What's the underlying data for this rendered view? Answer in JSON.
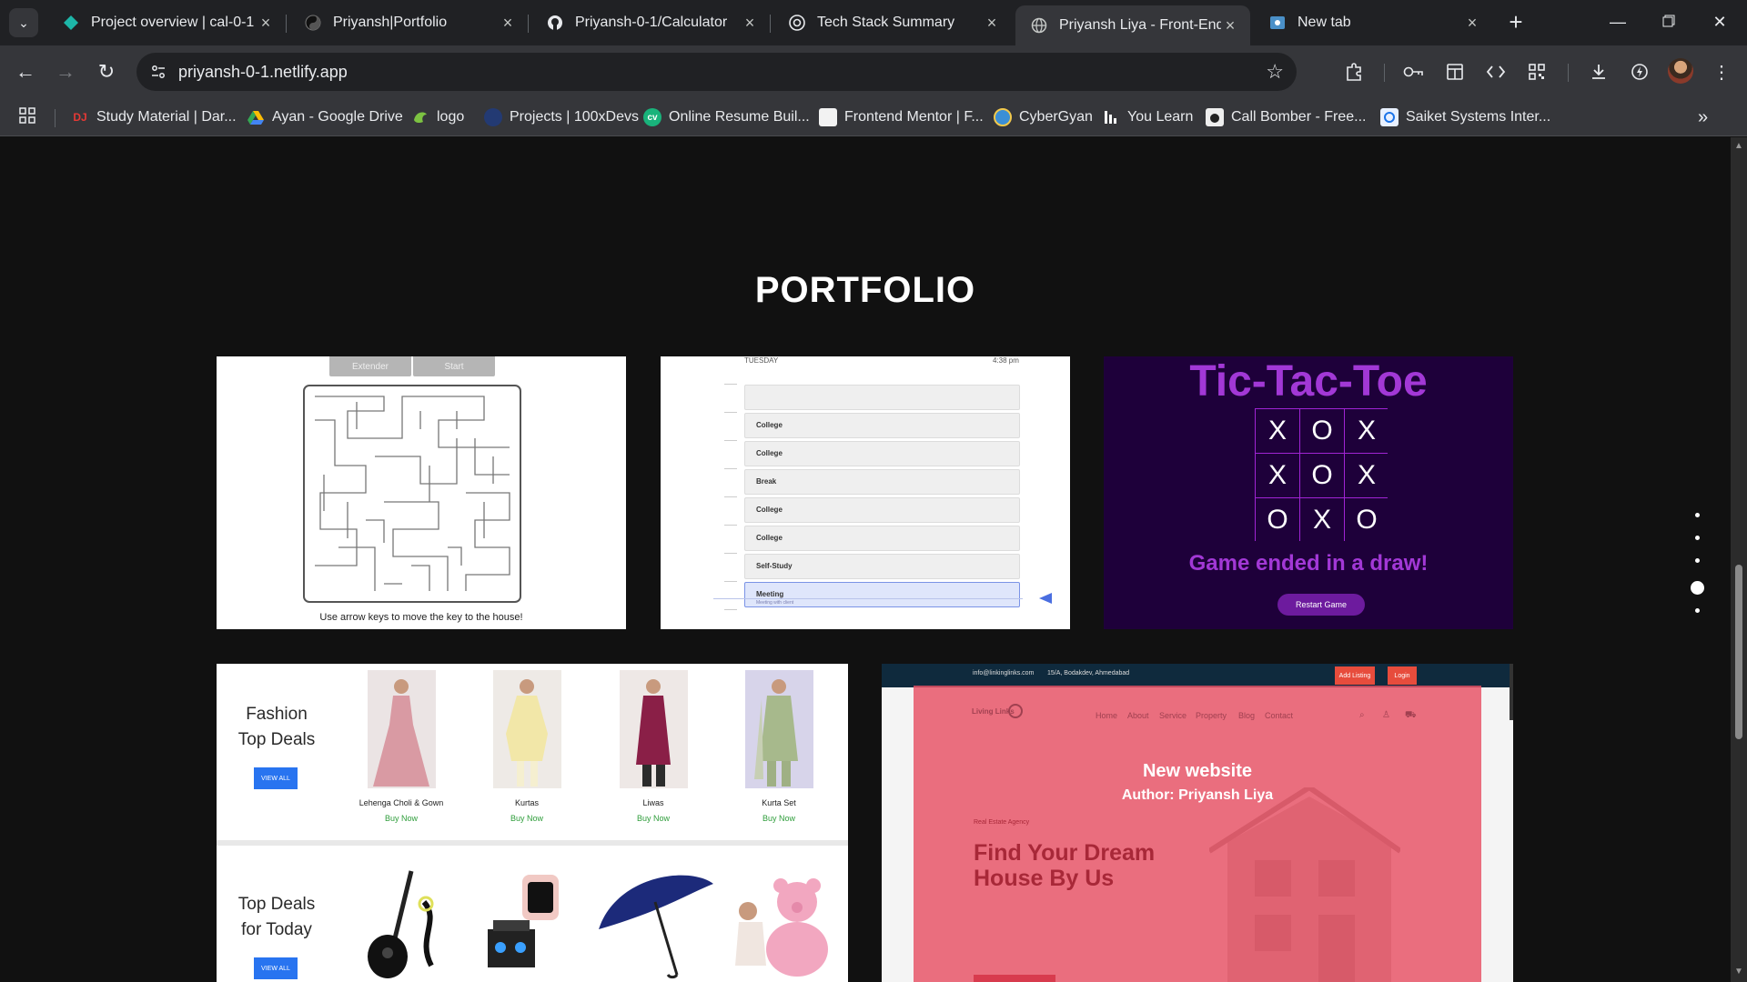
{
  "browser": {
    "tabs": [
      {
        "title": "Project overview | cal-0-1 |",
        "icon": "netlify-diamond-icon",
        "color": "#1db6a8"
      },
      {
        "title": "Priyansh|Portfolio",
        "icon": "yin-yang-icon"
      },
      {
        "title": "Priyansh-0-1/Calculator",
        "icon": "github-icon"
      },
      {
        "title": "Tech Stack Summary",
        "icon": "chatgpt-icon"
      },
      {
        "title": "Priyansh Liya - Front-End &",
        "icon": "globe-icon",
        "active": true
      },
      {
        "title": "New tab",
        "icon": "new-tab-icon"
      }
    ],
    "url": "priyansh-0-1.netlify.app",
    "bookmarks": [
      {
        "label": "Study Material | Dar...",
        "icon": "dj-icon"
      },
      {
        "label": "Ayan - Google Drive",
        "icon": "google-drive-icon"
      },
      {
        "label": "logo",
        "icon": "logo-icon"
      },
      {
        "label": "Projects | 100xDevs",
        "icon": "100xdevs-icon"
      },
      {
        "label": "Online Resume Buil...",
        "icon": "resume-icon"
      },
      {
        "label": "Frontend Mentor | F...",
        "icon": "frontend-mentor-icon"
      },
      {
        "label": "CyberGyan",
        "icon": "cybergyan-icon"
      },
      {
        "label": "You Learn",
        "icon": "youlearn-icon"
      },
      {
        "label": "Call Bomber - Free...",
        "icon": "call-bomber-icon"
      },
      {
        "label": "Saiket Systems Inter...",
        "icon": "saiket-icon"
      }
    ]
  },
  "page": {
    "title": "PORTFOLIO",
    "section_dots": 5,
    "active_dot": 4
  },
  "cards": {
    "maze": {
      "buttons": [
        "Extender",
        "Start"
      ],
      "caption": "Use arrow keys to move the key to the house!"
    },
    "schedule": {
      "day": "TUESDAY",
      "time": "4:38 pm",
      "rows": [
        "",
        "College",
        "College",
        "Break",
        "College",
        "College",
        "Self-Study",
        "Meeting"
      ],
      "meeting_sub": "Meeting with client"
    },
    "tictactoe": {
      "title": "Tic-Tac-Toe",
      "board": [
        "X",
        "O",
        "X",
        "X",
        "O",
        "X",
        "O",
        "X",
        "O"
      ],
      "status": "Game ended in a draw!",
      "button": "Restart Game"
    },
    "fashion": {
      "heading1": "Fashion Top Deals",
      "heading2": "Top Deals for Today",
      "view_all": "VIEW ALL",
      "products": [
        {
          "name": "Lehenga Choli & Gown",
          "buy": "Buy Now"
        },
        {
          "name": "Kurtas",
          "buy": "Buy Now"
        },
        {
          "name": "Liwas",
          "buy": "Buy Now"
        },
        {
          "name": "Kurta Set",
          "buy": "Buy Now"
        }
      ]
    },
    "realestate": {
      "top_email": "info@linkinglinks.com",
      "top_address": "15/A, Bodakdev, Ahmedabad",
      "add_listing": "Add Listing",
      "login": "Login",
      "brand": "Living Links",
      "nav": [
        "Home",
        "About",
        "Service",
        "Property",
        "Blog",
        "Contact"
      ],
      "tag": "Real Estate Agency",
      "hero": "Find Your Dream House By Us",
      "overlay_title": "New website",
      "overlay_author": "Author: Priyansh Liya"
    }
  },
  "colors": {
    "page_bg": "#111111",
    "chrome_dark": "#202124",
    "chrome_light": "#35363a",
    "ttt_bg": "#1e003a",
    "ttt_accent": "#a238d6",
    "overlay": "#e85064"
  }
}
